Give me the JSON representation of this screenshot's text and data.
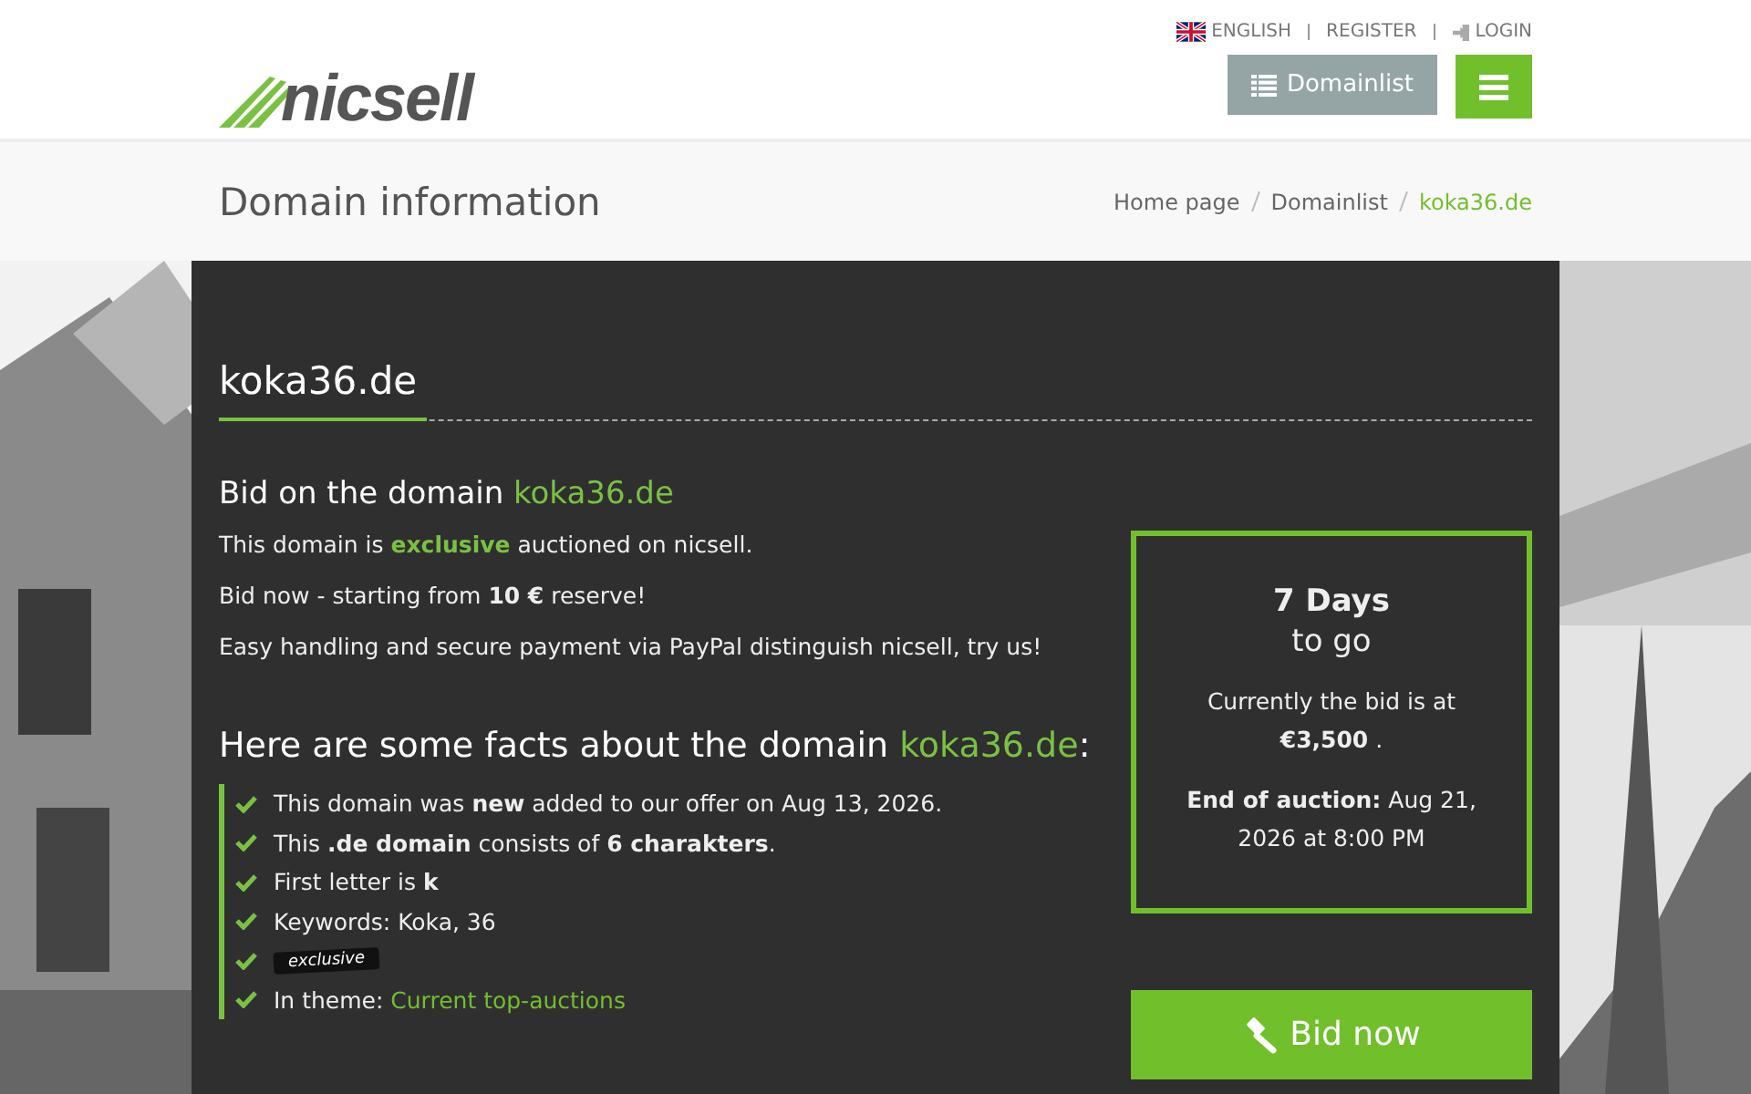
{
  "top_links": [
    {
      "kind": "flag",
      "label": "ENGLISH"
    },
    {
      "kind": "plain",
      "label": "REGISTER"
    },
    {
      "kind": "login",
      "label": "LOGIN"
    }
  ],
  "logo": {
    "text": "nicsell"
  },
  "header_buttons": {
    "domainlist": "Domainlist"
  },
  "page_title": "Domain information",
  "breadcrumb": [
    {
      "label": "Home page",
      "selected": false
    },
    {
      "label": "Domainlist",
      "selected": false
    },
    {
      "label": "koka36.de",
      "selected": true
    }
  ],
  "domain_title": "koka36.de",
  "bid_heading": {
    "before": "Bid on the domain ",
    "domain": "koka36.de"
  },
  "intro": [
    [
      {
        "text": "This domain is ",
        "highlight": false
      },
      {
        "text": "exclusive",
        "highlight": true
      },
      {
        "text": " auctioned on nicsell.",
        "highlight": false
      }
    ],
    [
      {
        "text": "Bid now - starting from **10 €** reserve!",
        "highlight": false
      }
    ],
    [
      {
        "text": "Easy handling and secure payment via PayPal distinguish nicsell, try us!",
        "highlight": false
      }
    ]
  ],
  "facts_heading": {
    "before": "Here are some facts about the domain ",
    "domain": "koka36.de",
    "after": ":"
  },
  "facts": [
    {
      "kind": "text",
      "text": "This domain was **new** added to our offer on Aug 13, 2026."
    },
    {
      "kind": "text",
      "text": "This **.de domain** consists of **6 charakters**."
    },
    {
      "kind": "text",
      "text": "First letter is **k**"
    },
    {
      "kind": "text",
      "text": "Keywords: Koka, 36"
    },
    {
      "kind": "badge",
      "text": "exclusive"
    },
    {
      "kind": "link",
      "text": "In theme: ",
      "link": "Current top-auctions"
    }
  ],
  "countdown": {
    "days": "7 Days",
    "to_go": "to go",
    "bid_label": "Currently the bid is at",
    "bid_value": "**€3,500** .",
    "end": "**End of auction:** Aug 21, 2026 at 8:00 PM"
  },
  "bid_button": "Bid now"
}
